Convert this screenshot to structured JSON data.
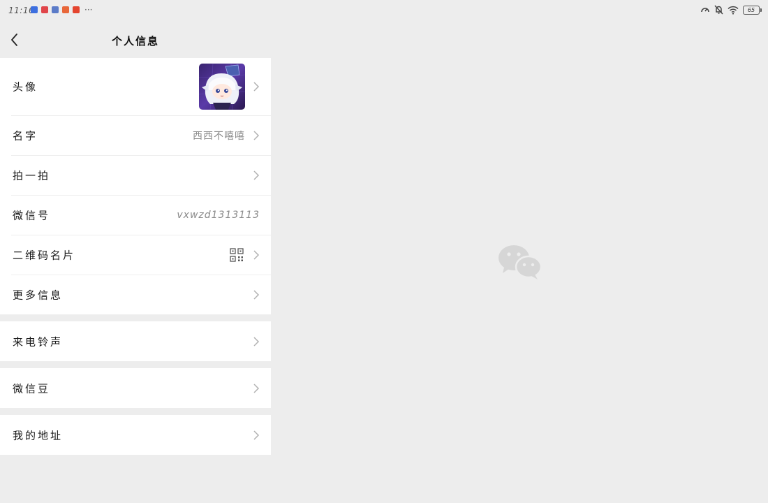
{
  "status_bar": {
    "time": "11:16",
    "app_icons": [
      {
        "name": "app-notification-icon-1",
        "color": "#3d6fe0"
      },
      {
        "name": "app-notification-icon-2",
        "color": "#e0454a"
      },
      {
        "name": "app-notification-icon-3",
        "color": "#5b7bc8"
      },
      {
        "name": "app-notification-icon-4",
        "color": "#e8673a"
      },
      {
        "name": "app-notification-icon-5",
        "color": "#e4452f"
      }
    ],
    "more": "···",
    "battery": "65"
  },
  "header": {
    "title": "个人信息"
  },
  "profile": {
    "avatar_row": {
      "label": "头像"
    },
    "name_row": {
      "label": "名字",
      "value": "西西不嘻嘻"
    },
    "pat_row": {
      "label": "拍一拍"
    },
    "wechat_id_row": {
      "label": "微信号",
      "value": "vxwzd1313113"
    },
    "qr_row": {
      "label": "二维码名片"
    },
    "more_row": {
      "label": "更多信息"
    }
  },
  "ringtone": {
    "label": "来电铃声"
  },
  "beans": {
    "label": "微信豆"
  },
  "address": {
    "label": "我的地址"
  },
  "colors": {
    "background": "#ededed",
    "card": "#ffffff",
    "secondary_text": "#8a8a8a",
    "placeholder_logo": "#d6d6d6"
  }
}
